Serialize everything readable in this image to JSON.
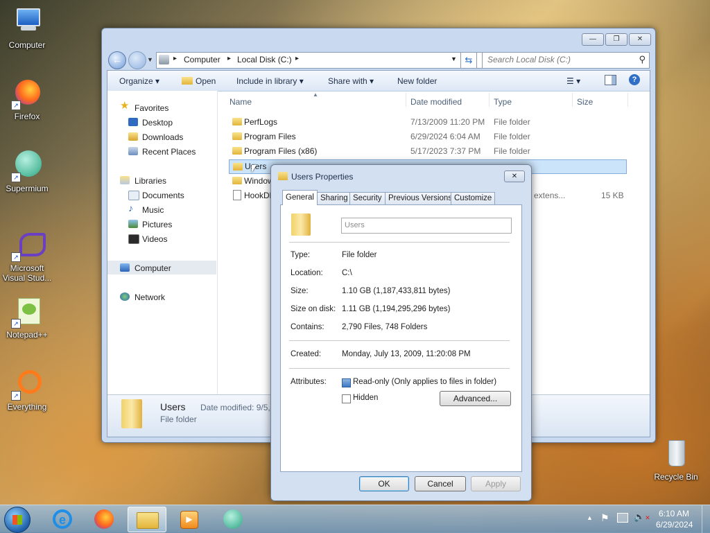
{
  "desktop": {
    "icons": [
      {
        "label": "Computer"
      },
      {
        "label": "Firefox"
      },
      {
        "label": "Supermium"
      },
      {
        "label": "Microsoft Visual Stud..."
      },
      {
        "label": "Notepad++"
      },
      {
        "label": "Everything"
      },
      {
        "label": "Recycle Bin"
      }
    ]
  },
  "explorer": {
    "address": {
      "segments": [
        "Computer",
        "Local Disk (C:)"
      ]
    },
    "search_placeholder": "Search Local Disk (C:)",
    "toolbar": {
      "organize": "Organize",
      "open": "Open",
      "include_in_library": "Include in library",
      "share_with": "Share with",
      "new_folder": "New folder"
    },
    "nav": {
      "favorites": "Favorites",
      "desktop": "Desktop",
      "downloads": "Downloads",
      "recent_places": "Recent Places",
      "libraries": "Libraries",
      "documents": "Documents",
      "music": "Music",
      "pictures": "Pictures",
      "videos": "Videos",
      "computer": "Computer",
      "network": "Network"
    },
    "columns": {
      "name": "Name",
      "date_modified": "Date modified",
      "type": "Type",
      "size": "Size"
    },
    "rows": [
      {
        "name": "PerfLogs",
        "date": "7/13/2009 11:20 PM",
        "type": "File folder",
        "size": ""
      },
      {
        "name": "Program Files",
        "date": "6/29/2024 6:04 AM",
        "type": "File folder",
        "size": ""
      },
      {
        "name": "Program Files (x86)",
        "date": "5/17/2023 7:37 PM",
        "type": "File folder",
        "size": ""
      },
      {
        "name": "Users",
        "date": "",
        "type": "",
        "size": ""
      },
      {
        "name": "Window",
        "date": "",
        "type": "",
        "size": ""
      },
      {
        "name": "HookDl",
        "date": "",
        "type": "n extens...",
        "size": "15 KB"
      }
    ],
    "details": {
      "name": "Users",
      "type": "File folder",
      "date_label": "Date modified: 9/5,"
    }
  },
  "dialog": {
    "title": "Users Properties",
    "tabs": [
      "General",
      "Sharing",
      "Security",
      "Previous Versions",
      "Customize"
    ],
    "name_field": "Users",
    "labels": {
      "type": "Type:",
      "location": "Location:",
      "size": "Size:",
      "size_on_disk": "Size on disk:",
      "contains": "Contains:",
      "created": "Created:",
      "attributes": "Attributes:"
    },
    "values": {
      "type": "File folder",
      "location": "C:\\",
      "size": "1.10 GB (1,187,433,811 bytes)",
      "size_on_disk": "1.11 GB (1,194,295,296 bytes)",
      "contains": "2,790 Files, 748 Folders",
      "created": "Monday, July 13, 2009, 11:20:08 PM"
    },
    "readonly_label": "Read-only (Only applies to files in folder)",
    "hidden_label": "Hidden",
    "advanced": "Advanced...",
    "ok": "OK",
    "cancel": "Cancel",
    "apply": "Apply"
  },
  "taskbar": {
    "time": "6:10 AM",
    "date": "6/29/2024"
  }
}
